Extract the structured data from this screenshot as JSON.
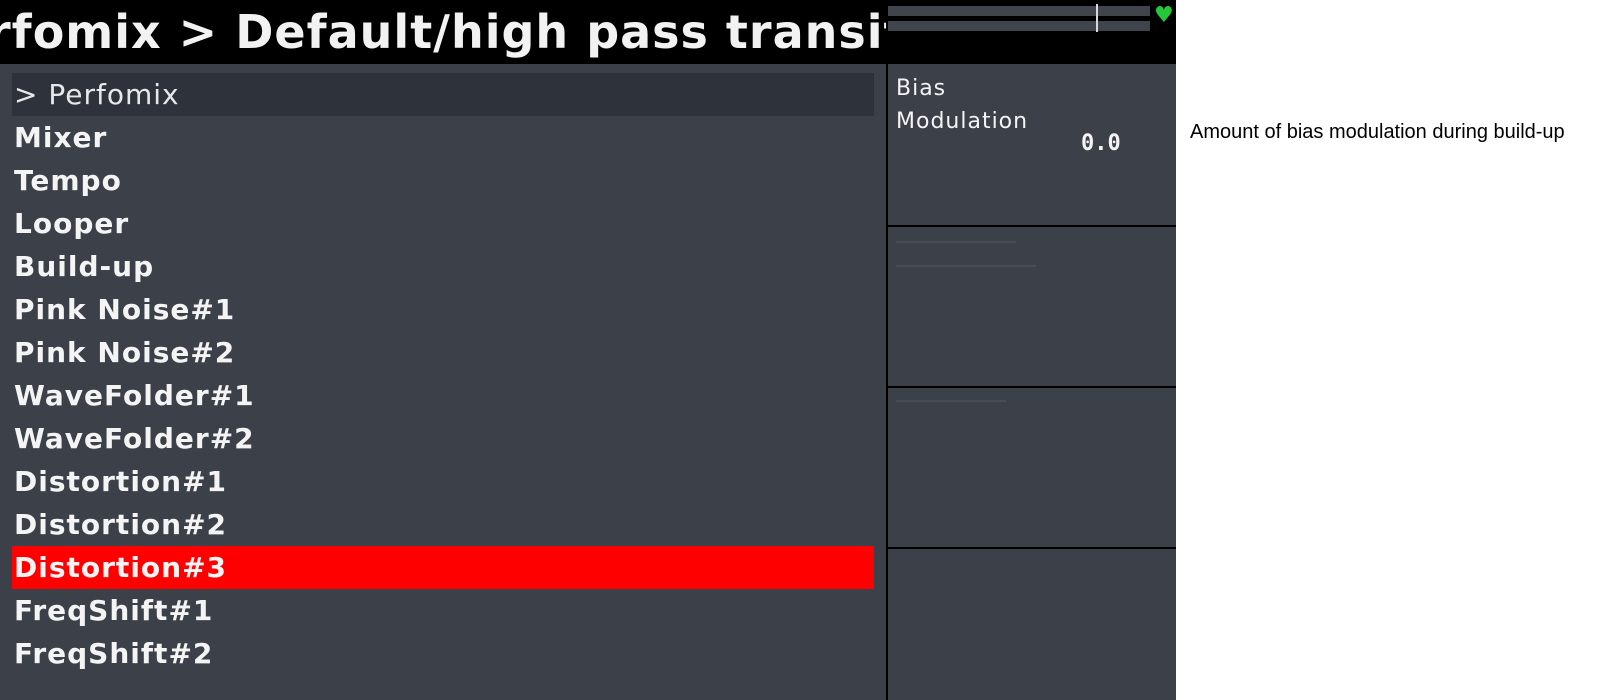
{
  "title": "rfomix > Default/high pass transit",
  "status": {
    "heart_icon": "heart-icon",
    "heart_color": "#22c83a"
  },
  "menu": {
    "parent_label": "> Perfomix",
    "items": [
      "Mixer",
      "Tempo",
      "Looper",
      "Build-up",
      "Pink Noise#1",
      "Pink Noise#2",
      "WaveFolder#1",
      "WaveFolder#2",
      "Distortion#1",
      "Distortion#2",
      "Distortion#3",
      "FreqShift#1",
      "FreqShift#2"
    ],
    "selected_item": "Distortion#3",
    "selected_color": "#ff0000"
  },
  "parameter": {
    "name": "Bias Modulation",
    "value": "0.0"
  },
  "description": "Amount of bias modulation during build-up"
}
